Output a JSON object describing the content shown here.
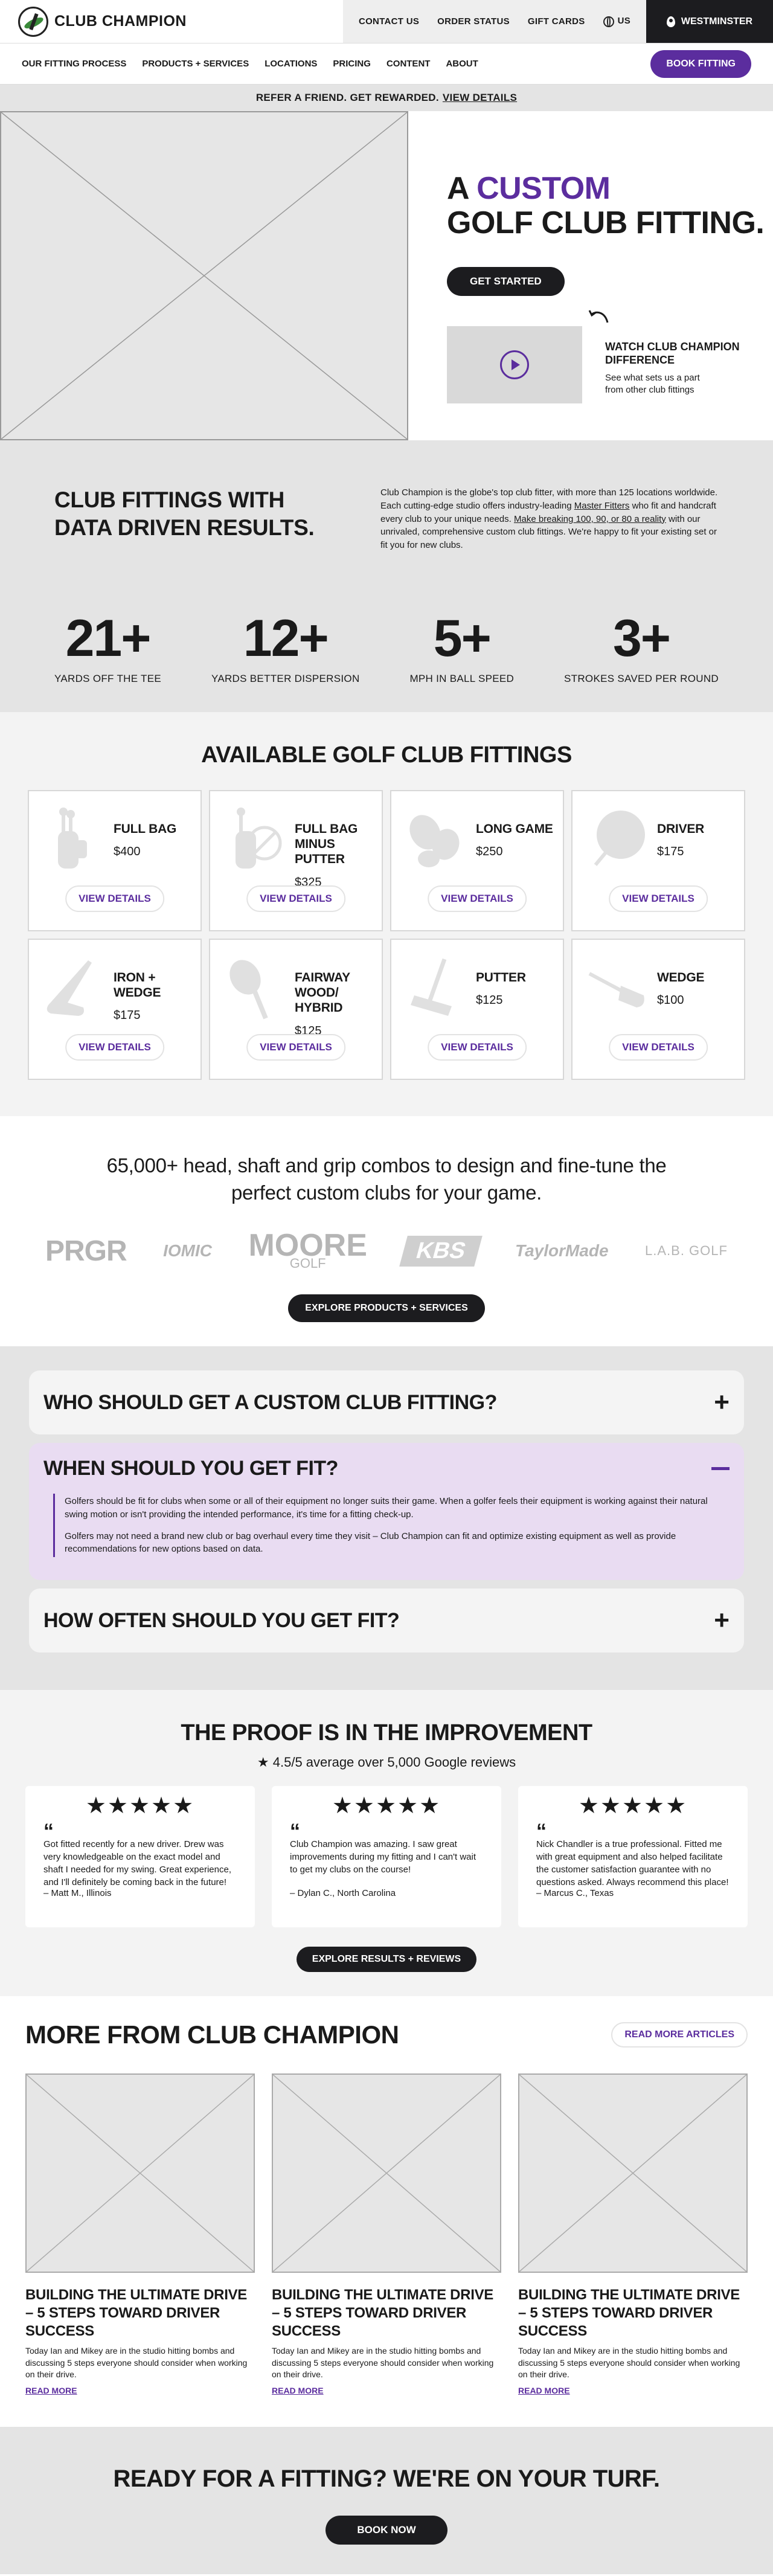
{
  "brand": {
    "name": "CLUB CHAMPION"
  },
  "util": {
    "contact": "CONTACT US",
    "order": "ORDER STATUS",
    "gift": "GIFT CARDS",
    "region": "US",
    "location": "WESTMINSTER"
  },
  "nav": {
    "items": [
      "OUR FITTING PROCESS",
      "PRODUCTS + SERVICES",
      "LOCATIONS",
      "PRICING",
      "CONTENT",
      "ABOUT"
    ],
    "cta": "BOOK FITTING"
  },
  "referral": {
    "text": "REFER A FRIEND. GET REWARDED.",
    "link": "VIEW DETAILS"
  },
  "hero": {
    "title_prefix": "A ",
    "title_accent": "CUSTOM",
    "title_line2": "GOLF CLUB FITTING.",
    "cta": "GET STARTED",
    "video_title": "WATCH CLUB CHAMPION DIFFERENCE",
    "video_text": "See what sets us a part from other club fittings"
  },
  "stats": {
    "title": "CLUB FITTINGS WITH DATA DRIVEN RESULTS.",
    "text_1": "Club Champion is the globe's top club fitter, with more than 125 locations worldwide. Each cutting-edge studio offers industry-leading ",
    "link_1": "Master Fitters",
    "text_2": " who fit and handcraft every club to your unique needs. ",
    "link_2": "Make breaking 100, 90, or 80 a reality",
    "text_3": " with our unrivaled, comprehensive custom club fittings. We're happy to fit your existing set or fit you for new clubs.",
    "items": [
      {
        "value": "21+",
        "label": "YARDS OFF THE TEE"
      },
      {
        "value": "12+",
        "label": "YARDS BETTER DISPERSION"
      },
      {
        "value": "5+",
        "label": "MPH IN BALL SPEED"
      },
      {
        "value": "3+",
        "label": "STROKES SAVED PER ROUND"
      }
    ]
  },
  "fittings": {
    "title": "AVAILABLE GOLF CLUB FITTINGS",
    "button": "VIEW DETAILS",
    "items": [
      {
        "name": "FULL BAG",
        "price": "$400",
        "icon": "golf-bag-icon"
      },
      {
        "name": "FULL BAG MINUS PUTTER",
        "price": "$325",
        "icon": "golf-bag-no-putter-icon"
      },
      {
        "name": "LONG GAME",
        "price": "$250",
        "icon": "long-game-icon"
      },
      {
        "name": "DRIVER",
        "price": "$175",
        "icon": "driver-icon"
      },
      {
        "name": "IRON + WEDGE",
        "price": "$175",
        "icon": "iron-icon"
      },
      {
        "name": "FAIRWAY WOOD/ HYBRID",
        "price": "$125",
        "icon": "fairway-wood-icon"
      },
      {
        "name": "PUTTER",
        "price": "$125",
        "icon": "putter-icon"
      },
      {
        "name": "WEDGE",
        "price": "$100",
        "icon": "wedge-icon"
      }
    ]
  },
  "brands": {
    "title": "65,000+ head, shaft and grip combos to design and fine-tune the perfect custom clubs for your game.",
    "logos": [
      "PRGR",
      "IOMIC",
      "MOORE",
      "GOLF",
      "KBS",
      "TaylorMade",
      "L.A.B. GOLF"
    ],
    "cta": "EXPLORE PRODUCTS + SERVICES"
  },
  "faq": {
    "items": [
      {
        "q": "WHO SHOULD GET A CUSTOM CLUB FITTING?",
        "toggle": "+"
      },
      {
        "q": "WHEN SHOULD YOU GET FIT?",
        "a1": "Golfers should be fit for clubs when some or all of their equipment no longer suits their game. When a golfer feels their equipment is working against their natural swing motion or isn't providing the intended performance, it's time for a fitting check-up.",
        "a2": "Golfers may not need a brand new club or bag overhaul every time they visit – Club Champion can fit and optimize existing equipment as well as provide recommendations for new options based on data."
      },
      {
        "q": "HOW OFTEN SHOULD YOU GET FIT?",
        "toggle": "+"
      }
    ]
  },
  "reviews": {
    "title": "THE PROOF IS IN THE IMPROVEMENT",
    "rating": "4.5/5 average over 5,000 Google reviews",
    "stars": "★★★★★",
    "quote_mark": "“",
    "items": [
      {
        "text": "Got fitted recently for a new driver. Drew was very knowledgeable on the exact model and shaft I needed for my swing. Great experience, and I'll definitely be coming back in the future!",
        "author": "– Matt M., Illinois"
      },
      {
        "text": "Club Champion was amazing. I saw great improvements during my fitting and I can't wait to get my clubs on the course!",
        "author": "– Dylan C., North Carolina"
      },
      {
        "text": "Nick Chandler is a true professional. Fitted me with great equipment and also helped facilitate the customer satisfaction guarantee with no questions asked. Always recommend this place!",
        "author": "– Marcus C., Texas"
      }
    ],
    "cta": "EXPLORE RESULTS + REVIEWS"
  },
  "articles": {
    "title": "MORE FROM CLUB CHAMPION",
    "cta": "READ MORE ARTICLES",
    "items": [
      {
        "title": "BUILDING THE ULTIMATE DRIVE – 5 STEPS TOWARD DRIVER SUCCESS",
        "text": "Today Ian and Mikey are in the studio hitting bombs and discussing 5 steps everyone should consider when working on their drive.",
        "link": "READ MORE"
      },
      {
        "title": "BUILDING THE ULTIMATE DRIVE – 5 STEPS TOWARD DRIVER SUCCESS",
        "text": "Today Ian and Mikey are in the studio hitting bombs and discussing 5 steps everyone should consider when working on their drive.",
        "link": "READ MORE"
      },
      {
        "title": "BUILDING THE ULTIMATE DRIVE – 5 STEPS TOWARD DRIVER SUCCESS",
        "text": "Today Ian and Mikey are in the studio hitting bombs and discussing 5 steps everyone should consider when working on their drive.",
        "link": "READ MORE"
      }
    ]
  },
  "cta": {
    "title": "READY FOR A FITTING? WE'RE ON YOUR TURF.",
    "button": "BOOK NOW"
  },
  "colors": {
    "accent": "#5b2d9e",
    "dark": "#1c1c1f",
    "gray_bg": "#e4e4e4",
    "faq_open": "#e9dcf2"
  }
}
